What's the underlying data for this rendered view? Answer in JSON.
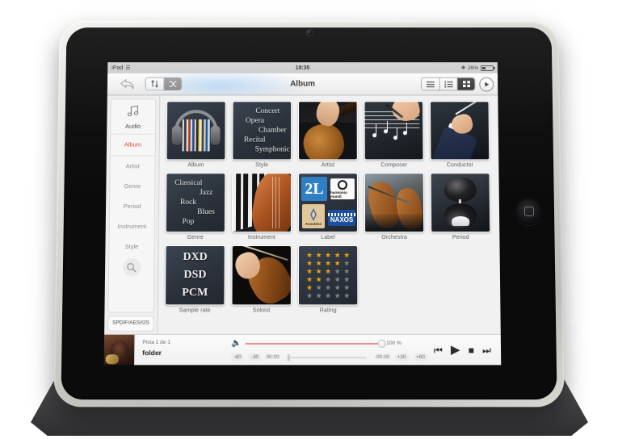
{
  "status_bar": {
    "device": "iPad",
    "wifi_icon": "wifi-icon",
    "time": "18:35",
    "bluetooth_icon": "bluetooth-icon",
    "battery_percent": "26%"
  },
  "toolbar": {
    "back_icon": "back-arrow-icon",
    "sort_alpha_icon": "sort-ascending-icon",
    "sort_shuffle_icon": "shuffle-icon",
    "title": "Album",
    "view_list_icon": "list-view-icon",
    "view_detail_icon": "detail-list-view-icon",
    "view_grid_icon": "grid-view-icon",
    "play_icon": "play-icon"
  },
  "sidebar": {
    "audio": {
      "label": "Audio",
      "icon": "music-note-icon"
    },
    "items": [
      {
        "label": "Album",
        "active": true
      },
      {
        "label": "Artist",
        "active": false
      },
      {
        "label": "Genre",
        "active": false
      },
      {
        "label": "Period",
        "active": false
      },
      {
        "label": "Instrument",
        "active": false
      },
      {
        "label": "Style",
        "active": false
      }
    ],
    "search_icon": "search-icon",
    "spdif_label": "SPDIF/AES/I2S"
  },
  "grid": {
    "tiles": [
      {
        "caption": "Album",
        "art": "headphones-cds"
      },
      {
        "caption": "Style",
        "art": "style-words",
        "words": [
          "Concert",
          "Opera",
          "Chamber",
          "Recital",
          "Symphonic"
        ]
      },
      {
        "caption": "Artist",
        "art": "guitar-photo"
      },
      {
        "caption": "Composer",
        "art": "hand-writing-score"
      },
      {
        "caption": "Conductor",
        "art": "conductor-baton"
      },
      {
        "caption": "Genre",
        "art": "genre-words",
        "words": [
          "Classical",
          "Jazz",
          "Rock",
          "Blues",
          "Pop"
        ]
      },
      {
        "caption": "Instrument",
        "art": "piano-cello"
      },
      {
        "caption": "Label",
        "art": "record-labels",
        "labels": [
          "2L",
          "harmonia mundi",
          "AcouDisc",
          "NAXOS"
        ]
      },
      {
        "caption": "Orchestra",
        "art": "cellists-photo"
      },
      {
        "caption": "Period",
        "art": "hourglass"
      },
      {
        "caption": "Sample rate",
        "art": "format-words",
        "words": [
          "DXD",
          "DSD",
          "PCM"
        ]
      },
      {
        "caption": "Soloist",
        "art": "violin-photo"
      },
      {
        "caption": "Rating",
        "art": "star-grid",
        "rows": [
          5,
          4,
          3,
          2,
          1,
          0
        ],
        "max": 5
      }
    ]
  },
  "player": {
    "artwork": "album-artwork",
    "track_position": "Pista 1 de 1",
    "title": "folder",
    "volume_icon": "volume-icon",
    "volume_percent": "100 %",
    "skip_back_60": "-60",
    "skip_back_30": "-30",
    "elapsed_time": "00:00",
    "remaining_time": "-00:00",
    "skip_fwd_30": "+30",
    "skip_fwd_60": "+60",
    "previous_icon": "previous-track-icon",
    "play_icon": "play-icon",
    "stop_icon": "stop-icon",
    "next_icon": "next-track-icon"
  },
  "colors": {
    "accent_red": "#e0493b",
    "volume_track": "#e8908a",
    "star_gold": "#e8a317",
    "star_gray": "#7e848a"
  }
}
